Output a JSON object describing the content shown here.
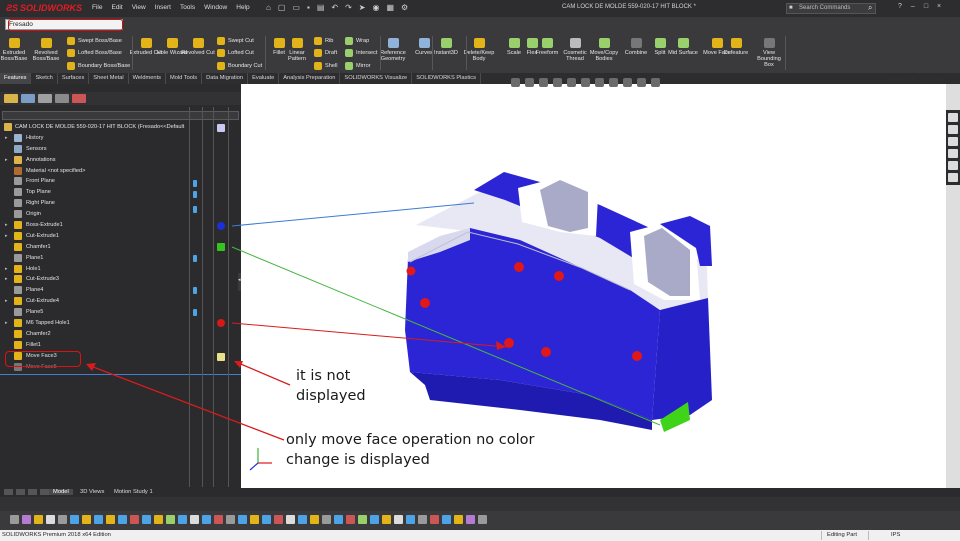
{
  "app": {
    "logo": "SOLIDWORKS",
    "menu": [
      "File",
      "Edit",
      "View",
      "Insert",
      "Tools",
      "Window",
      "Help"
    ],
    "doc_title": "CAM LOCK DE MOLDE 559-020-17 HIT BLOCK *",
    "search_placeholder": "Search Commands",
    "window_controls": [
      "?",
      "–",
      "□",
      "×"
    ]
  },
  "config": {
    "value": "Fresado"
  },
  "ribbon": {
    "big_buttons": [
      {
        "label": "Extruded Boss/Base",
        "color": "#e3b31a"
      },
      {
        "label": "Revolved Boss/Base",
        "color": "#e3b31a"
      },
      {
        "label": "Extruded Cut",
        "color": "#e3b31a"
      },
      {
        "label": "Hole Wizard",
        "color": "#e3b31a"
      },
      {
        "label": "Revolved Cut",
        "color": "#e3b31a"
      },
      {
        "label": "Fillet",
        "color": "#e3b31a"
      },
      {
        "label": "Linear Pattern",
        "color": "#e3b31a"
      },
      {
        "label": "Reference Geometry",
        "color": "#8fb3d9"
      },
      {
        "label": "Curves",
        "color": "#8fb3d9"
      },
      {
        "label": "Instant3D",
        "color": "#9ad06b"
      },
      {
        "label": "Delete/Keep Body",
        "color": "#e3b31a"
      },
      {
        "label": "Scale",
        "color": "#9ad06b"
      },
      {
        "label": "Flex",
        "color": "#9ad06b"
      },
      {
        "label": "Freeform",
        "color": "#9ad06b"
      },
      {
        "label": "Cosmetic Thread",
        "color": "#bbbbbb"
      },
      {
        "label": "Move/Copy Bodies",
        "color": "#9ad06b"
      },
      {
        "label": "Combine",
        "color": "#777777"
      },
      {
        "label": "Split",
        "color": "#9ad06b"
      },
      {
        "label": "Mid Surface",
        "color": "#9ad06b"
      },
      {
        "label": "Move Face",
        "color": "#e3b31a"
      },
      {
        "label": "Defeature",
        "color": "#e3b31a"
      },
      {
        "label": "View Bounding Box",
        "color": "#777777"
      }
    ],
    "small_buttons": [
      "Swept Boss/Base",
      "Lofted Boss/Base",
      "Boundary Boss/Base",
      "Swept Cut",
      "Lofted Cut",
      "Boundary Cut",
      "Rib",
      "Draft",
      "Shell",
      "Wrap",
      "Intersect",
      "Mirror"
    ]
  },
  "command_tabs": [
    "Features",
    "Sketch",
    "Surfaces",
    "Sheet Metal",
    "Weldments",
    "Mold Tools",
    "Data Migration",
    "Evaluate",
    "Analysis Preparation",
    "SOLIDWORKS Visualize",
    "SOLIDWORKS Plastics"
  ],
  "tree": {
    "root": "CAM LOCK DE MOLDE 559-020-17 HIT BLOCK  (Fresado<<Default",
    "items": [
      {
        "label": "History",
        "expand": "▸",
        "icon": "#9bb4d1"
      },
      {
        "label": "Sensors",
        "expand": "",
        "icon": "#8fa9c8"
      },
      {
        "label": "Annotations",
        "expand": "▸",
        "icon": "#e0b34a"
      },
      {
        "label": "Material <not specified>",
        "expand": "",
        "icon": "#b06b2f"
      },
      {
        "label": "Front Plane",
        "expand": "",
        "icon": "#9a9a9a"
      },
      {
        "label": "Top Plane",
        "expand": "",
        "icon": "#9a9a9a"
      },
      {
        "label": "Right Plane",
        "expand": "",
        "icon": "#9a9a9a"
      },
      {
        "label": "Origin",
        "expand": "",
        "icon": "#9a9a9a"
      },
      {
        "label": "Boss-Extrude1",
        "expand": "▸",
        "icon": "#e3b31a"
      },
      {
        "label": "Cut-Extrude1",
        "expand": "▸",
        "icon": "#e3b31a"
      },
      {
        "label": "Chamfer1",
        "expand": "",
        "icon": "#e3b31a"
      },
      {
        "label": "Plane1",
        "expand": "",
        "icon": "#9a9a9a"
      },
      {
        "label": "Hole1",
        "expand": "▸",
        "icon": "#e3b31a"
      },
      {
        "label": "Cut-Extrude3",
        "expand": "▸",
        "icon": "#e3b31a"
      },
      {
        "label": "Plane4",
        "expand": "",
        "icon": "#9a9a9a"
      },
      {
        "label": "Cut-Extrude4",
        "expand": "▸",
        "icon": "#e3b31a"
      },
      {
        "label": "Plane5",
        "expand": "",
        "icon": "#9a9a9a"
      },
      {
        "label": "M6 Tapped Hole1",
        "expand": "▸",
        "icon": "#e3b31a"
      },
      {
        "label": "Chamfer2",
        "expand": "",
        "icon": "#e3b31a"
      },
      {
        "label": "Fillet1",
        "expand": "",
        "icon": "#e3b31a"
      },
      {
        "label": "Move Face3",
        "expand": "",
        "icon": "#e3b31a"
      },
      {
        "label": "Move Face5",
        "expand": "",
        "icon": "#777777",
        "dim": true
      }
    ]
  },
  "appearances": {
    "part_color": "#c8c8f0",
    "blue": "#1d2fd6",
    "green": "#35c41f",
    "red": "#d61818",
    "yellow": "#e9e08a"
  },
  "model": {
    "body_color": "#2b25d6",
    "edge_color": "#c0c0d0",
    "hole_color": "#e01818",
    "moved_face_color": "#3fd31a"
  },
  "annotations": {
    "note1_line1": "it is not",
    "note1_line2": "displayed",
    "note2_line1": "only move face operation no color",
    "note2_line2": "change is displayed"
  },
  "bottom_tabs": [
    "Model",
    "3D Views",
    "Motion Study 1"
  ],
  "status": {
    "left": "SOLIDWORKS Premium 2018 x64 Edition",
    "editing": "Editing Part",
    "units": "IPS"
  }
}
